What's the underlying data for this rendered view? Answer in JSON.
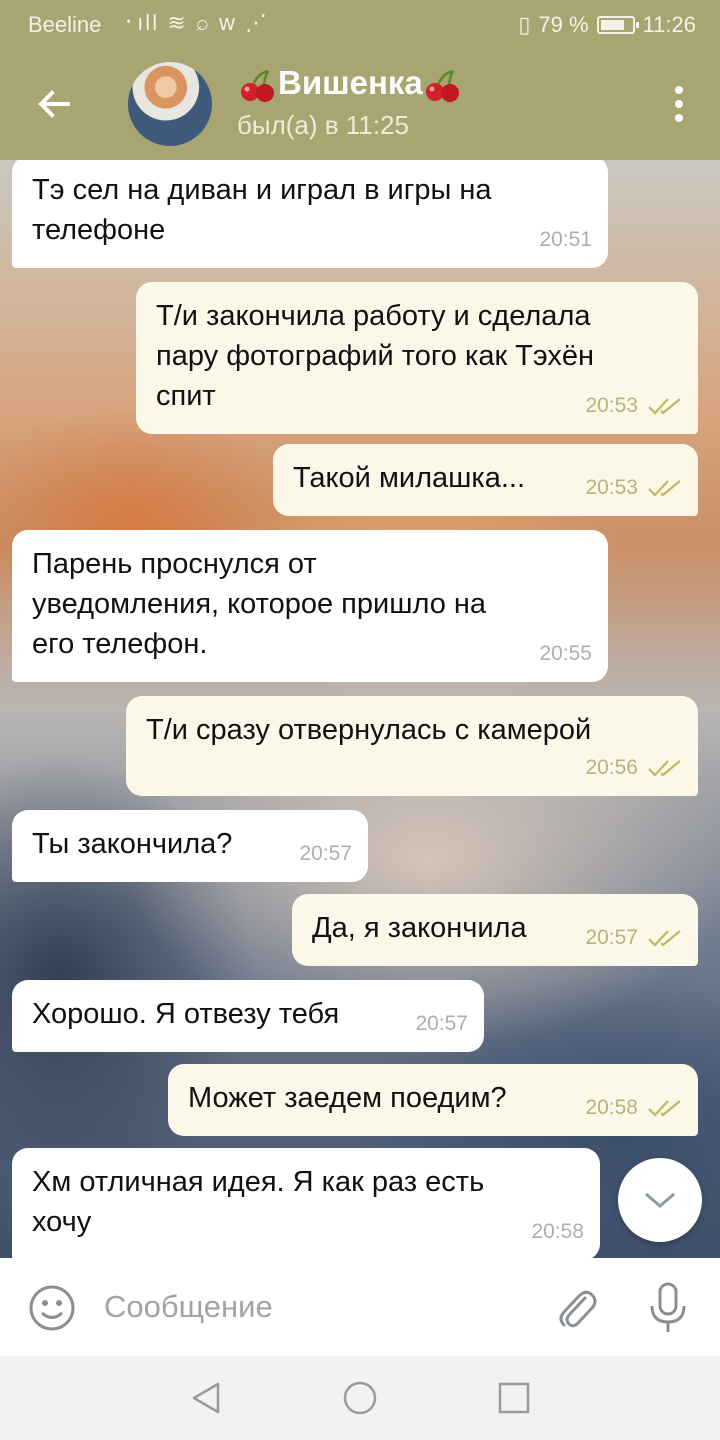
{
  "statusbar": {
    "carrier": "Beeline",
    "signal_icons": "᛫ıll ≋ ⌕ w ⋰",
    "battery_text": "79 %",
    "battery_level": 0.79,
    "time": "11:26"
  },
  "header": {
    "back_icon": "arrow-left",
    "contact_name": "Вишенка",
    "status": "был(а) в 11:25",
    "menu_icon": "more-vertical"
  },
  "messages": [
    {
      "dir": "in",
      "text": "Тэ сел на диван и играл в игры на\nтелефоне",
      "time": "20:51"
    },
    {
      "dir": "out",
      "text": "Т/и закончила работу и сделала\nпару фотографий того как Тэхён\nспит",
      "time": "20:53"
    },
    {
      "dir": "out",
      "text": "Такой милашка...",
      "time": "20:53"
    },
    {
      "dir": "in",
      "text": "Парень проснулся от\nуведомления, которое пришло на\nего телефон.",
      "time": "20:55"
    },
    {
      "dir": "out",
      "text": "Т/и сразу отвернулась с камерой",
      "time": "20:56"
    },
    {
      "dir": "in",
      "text": "Ты закончила?",
      "time": "20:57"
    },
    {
      "dir": "out",
      "text": "Да, я закончила",
      "time": "20:57"
    },
    {
      "dir": "in",
      "text": "Хорошо. Я отвезу тебя",
      "time": "20:57"
    },
    {
      "dir": "out",
      "text": "Может заедем поедим?",
      "time": "20:58"
    },
    {
      "dir": "in",
      "text": "Хм отличная идея. Я как раз есть\nхочу",
      "time": "20:58"
    }
  ],
  "input": {
    "placeholder": "Сообщение",
    "value": ""
  },
  "colors": {
    "header": "#a8a573",
    "incoming_bubble": "#ffffff",
    "outgoing_bubble": "#fbf8e9",
    "read_ticks": "#c2b75e"
  }
}
